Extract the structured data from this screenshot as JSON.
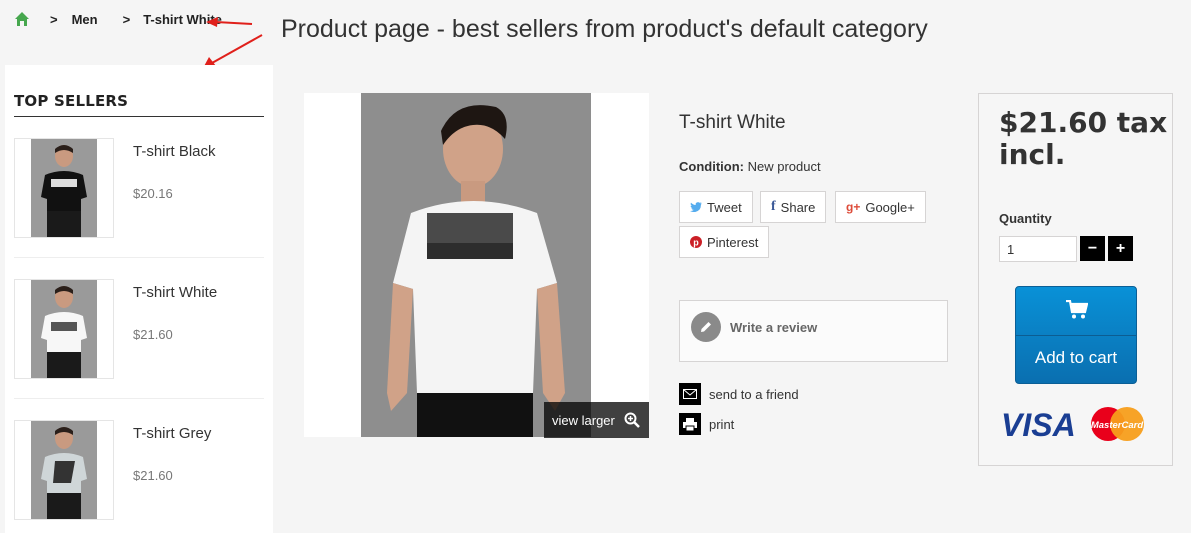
{
  "breadcrumb": {
    "home_icon": "home-icon",
    "separator": ">",
    "items": [
      "Men",
      "T-shirt White"
    ]
  },
  "annotation": {
    "title": "Product page - best sellers from product's default category"
  },
  "sidebar": {
    "title": "TOP SELLERS",
    "items": [
      {
        "name": "T-shirt Black",
        "price": "$20.16",
        "shirt_color": "#111111"
      },
      {
        "name": "T-shirt White",
        "price": "$21.60",
        "shirt_color": "#f7f7f7"
      },
      {
        "name": "T-shirt Grey",
        "price": "$21.60",
        "shirt_color": "#cfd6d8"
      }
    ]
  },
  "product": {
    "name": "T-shirt White",
    "condition_label": "Condition:",
    "condition_value": "New product",
    "view_larger": "view larger",
    "social": {
      "tweet": "Tweet",
      "share": "Share",
      "google": "Google+",
      "pinterest": "Pinterest"
    },
    "write_review": "Write a review",
    "send_to_friend": "send to a friend",
    "print": "print"
  },
  "buy": {
    "price": "$21.60 tax incl.",
    "quantity_label": "Quantity",
    "quantity_value": "1",
    "minus": "−",
    "plus": "+",
    "add_to_cart": "Add to cart",
    "card_visa": "VISA",
    "card_mastercard": "MasterCard"
  },
  "colors": {
    "accent_blue": "#0a7fc4",
    "annotation_arrow": "#e0201b",
    "home_green": "#46a74e",
    "twitter": "#55acee",
    "google": "#dd4b39",
    "pinterest": "#cb2027"
  }
}
